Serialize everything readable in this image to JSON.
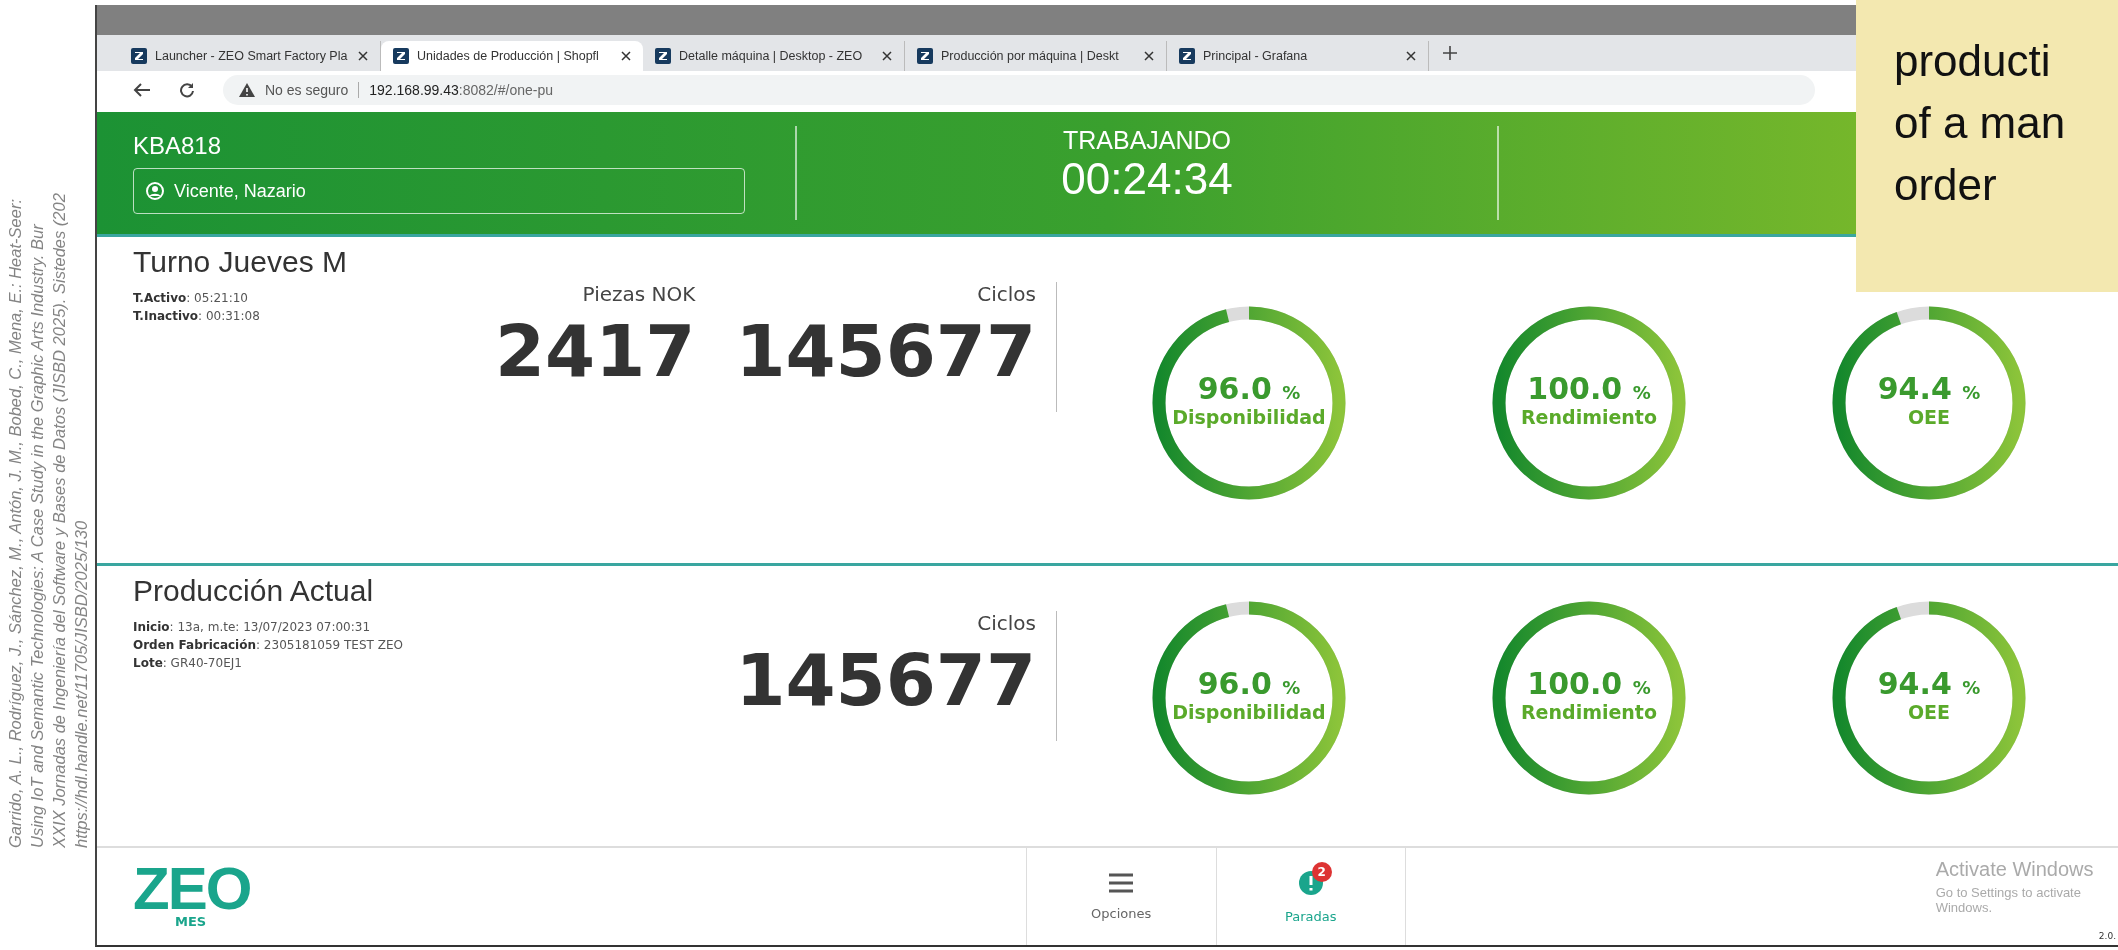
{
  "browser": {
    "tabs": [
      {
        "label": "Launcher - ZEO Smart Factory Pla",
        "selected": false
      },
      {
        "label": "Unidades de Producción | Shopfl",
        "selected": true
      },
      {
        "label": "Detalle máquina | Desktop - ZEO",
        "selected": false
      },
      {
        "label": "Producción por máquina | Deskt",
        "selected": false
      },
      {
        "label": "Principal - Grafana",
        "selected": false
      }
    ],
    "address": {
      "warning": "No es seguro",
      "host": "192.168.99.43",
      "path": ":8082/#/one-pu"
    }
  },
  "header": {
    "machine": "KBA818",
    "operator": "Vicente, Nazario",
    "status": "TRABAJANDO",
    "timer": "00:24:34"
  },
  "sections": [
    {
      "title": "Turno Jueves M",
      "details": [
        {
          "label": "T.Activo",
          "value": ": 05:21:10"
        },
        {
          "label": "T.Inactivo",
          "value": ": 00:31:08"
        }
      ],
      "stats": [
        {
          "label": "Piezas NOK",
          "value": "2417"
        },
        {
          "label": "Ciclos",
          "value": "145677"
        }
      ],
      "gauges": [
        {
          "value": "96.0",
          "unit": "%",
          "label": "Disponibilidad",
          "level": 0.96
        },
        {
          "value": "100.0",
          "unit": "%",
          "label": "Rendimiento",
          "level": 1.0
        },
        {
          "value": "94.4",
          "unit": "%",
          "label": "OEE",
          "level": 0.944
        }
      ]
    },
    {
      "title": "Producción Actual",
      "details": [
        {
          "label": "Inicio",
          "value": ": 13a, m.te: 13/07/2023 07:00:31"
        },
        {
          "label": "Orden Fabricación",
          "value": ": 2305181059 TEST ZEO"
        },
        {
          "label": "Lote",
          "value": ": GR40-70EJ1"
        }
      ],
      "stats": [
        {
          "label": "Ciclos",
          "value": "145677"
        }
      ],
      "gauges": [
        {
          "value": "96.0",
          "unit": "%",
          "label": "Disponibilidad",
          "level": 0.96
        },
        {
          "value": "100.0",
          "unit": "%",
          "label": "Rendimiento",
          "level": 1.0
        },
        {
          "value": "94.4",
          "unit": "%",
          "label": "OEE",
          "level": 0.944
        }
      ]
    }
  ],
  "footer": {
    "logo": "ZEO",
    "logo_sub": "MES",
    "nav": [
      {
        "label": "Opciones",
        "kind": "menu",
        "selected": false
      },
      {
        "label": "Paradas",
        "kind": "alert",
        "badge": "2",
        "selected": true
      }
    ]
  },
  "os_notice": {
    "title": "Activate Windows",
    "subtitle": "Go to Settings to activate Windows."
  },
  "version": "2.0.",
  "caption": [
    "producti",
    "of a man",
    "order"
  ],
  "citation": [
    "Garrido, A. L., Rodríguez, J., Sánchez, M., Antón, J. M., Bobed, C., Mena, E.: Heat-Seer:",
    "Using IoT and Semantic Technologies: A Case Study in the Graphic Arts Industry. Bur",
    "XXIX Jornadas de Ingeniería del Software y Bases de Datos (JISBD 2025). Sistedes (202",
    "https://hdl.handle.net/11705/JISBD/2025/130"
  ]
}
